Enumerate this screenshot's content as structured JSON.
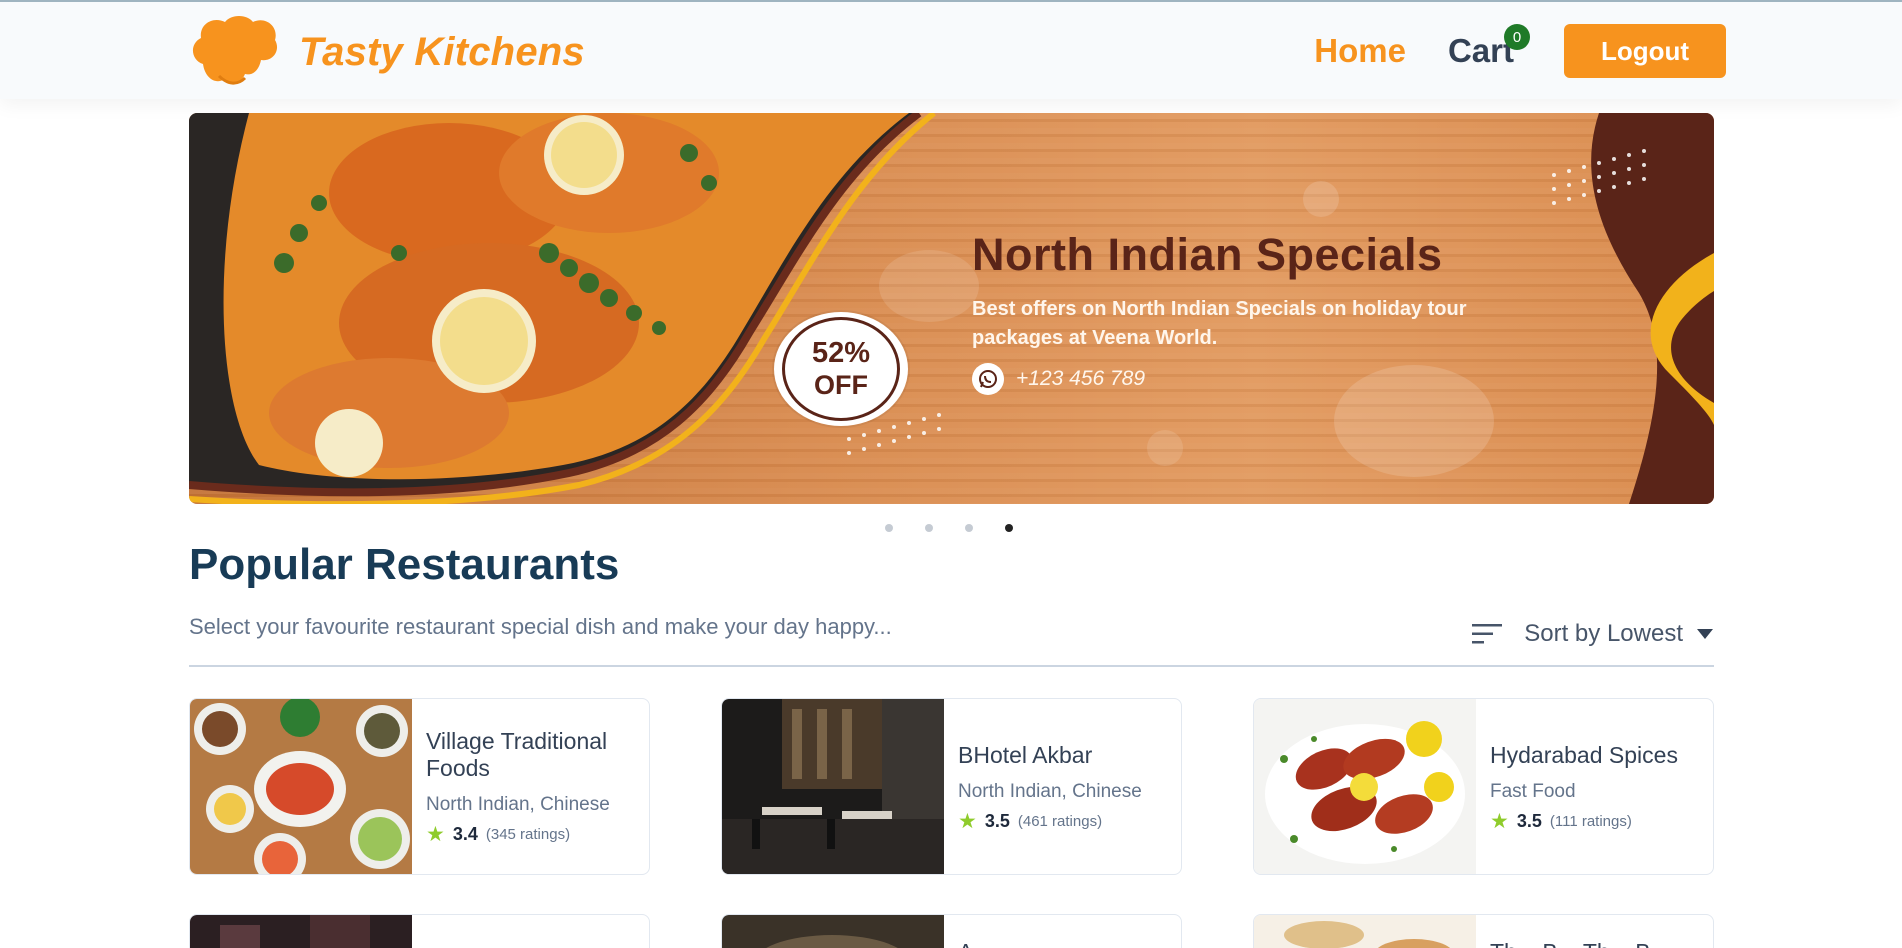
{
  "header": {
    "brand": "Tasty Kitchens",
    "nav": {
      "home": "Home",
      "cart": "Cart",
      "cart_count": "0"
    },
    "logout_label": "Logout"
  },
  "banner": {
    "title": "North Indian Specials",
    "subtitle": "Best offers on North Indian Specials on holiday tour packages at Veena World.",
    "phone": "+123 456 789",
    "offer_percent": "52%",
    "offer_word": "OFF",
    "slides_total": 4,
    "active_slide": 4
  },
  "popular": {
    "title": "Popular Restaurants",
    "subtitle": "Select your favourite restaurant special dish and make your day happy...",
    "sort_label": "Sort by Lowest"
  },
  "restaurants": [
    {
      "name": "Village Traditional Foods",
      "cuisine": "North Indian, Chinese",
      "rating": "3.4",
      "ratings_count": "(345 ratings)"
    },
    {
      "name": "BHotel Akbar",
      "cuisine": "North Indian, Chinese",
      "rating": "3.5",
      "ratings_count": "(461 ratings)"
    },
    {
      "name": "Hydarabad Spices",
      "cuisine": "Fast Food",
      "rating": "3.5",
      "ratings_count": "(111 ratings)"
    }
  ],
  "partial_restaurants": [
    {
      "name": ""
    },
    {
      "name": "A..."
    },
    {
      "name": "Th... B... Th... B..."
    }
  ],
  "colors": {
    "accent": "#f7931e",
    "heading": "#183b56",
    "star": "#8fcc2c",
    "cart_badge": "#1f7a28",
    "banner_dark": "#5a2418"
  }
}
